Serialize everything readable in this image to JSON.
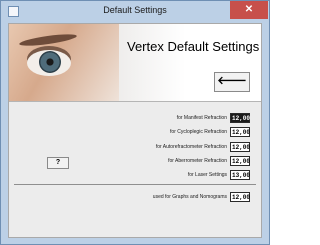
{
  "window": {
    "title": "Default Settings",
    "close_label": "✕"
  },
  "header": {
    "title": "Vertex Default Settings",
    "back_button_label": "🡐"
  },
  "help_button_label": "?",
  "settings": [
    {
      "label": "for Manifest Refraction",
      "value": "12,00",
      "selected": true
    },
    {
      "label": "for Cycloplegic Refraction",
      "value": "12,00",
      "selected": false
    },
    {
      "label": "for Autorefractometer Refraction",
      "value": "12,00",
      "selected": false
    },
    {
      "label": "for Aberrometer Refraction",
      "value": "12,00",
      "selected": false
    },
    {
      "label": "for Laser Settings",
      "value": "13,00",
      "selected": false
    }
  ],
  "graphs_setting": {
    "label": "used for Graphs and Nomograms",
    "value": "12,00"
  }
}
